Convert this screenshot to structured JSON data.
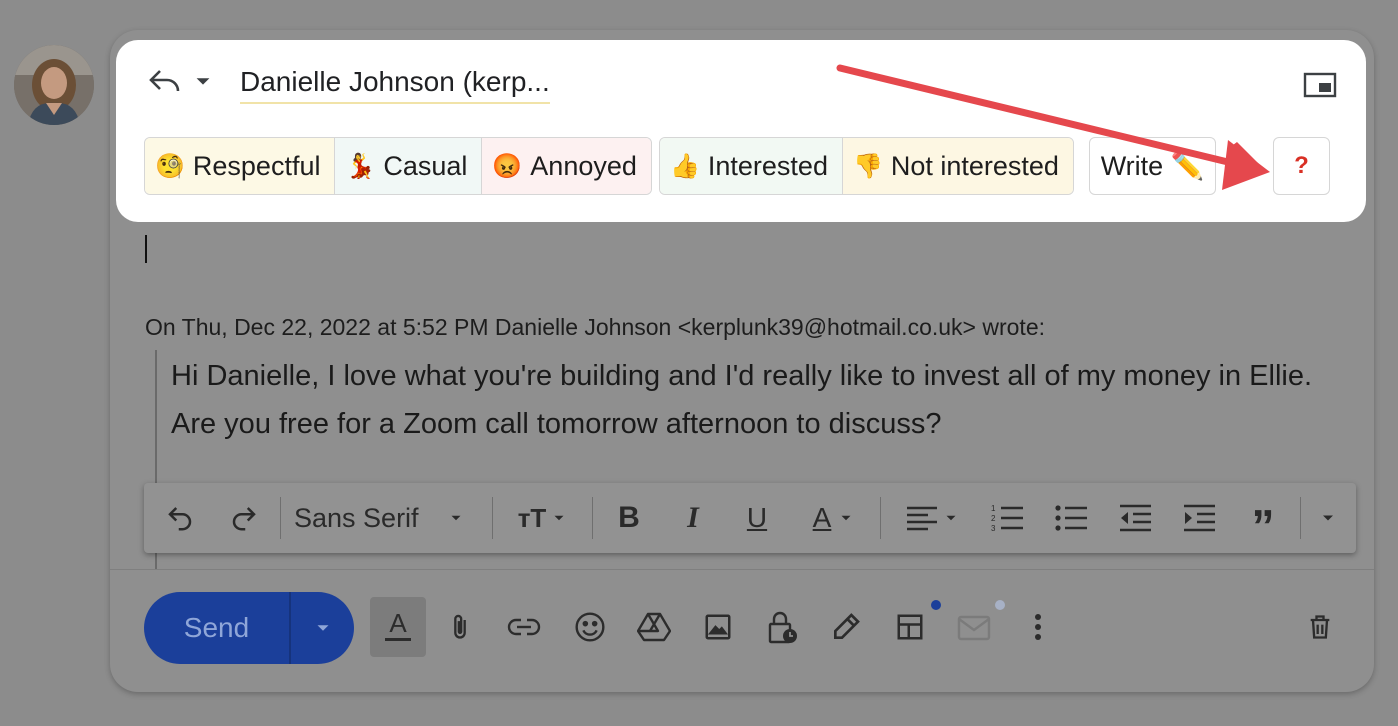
{
  "reply": {
    "recipient": "Danielle Johnson (kerp..."
  },
  "tones": {
    "group1": [
      {
        "emoji": "🧐",
        "label": "Respectful"
      },
      {
        "emoji": "💃",
        "label": "Casual"
      },
      {
        "emoji": "😡",
        "label": "Annoyed"
      }
    ],
    "group2": [
      {
        "emoji": "👍",
        "label": "Interested"
      },
      {
        "emoji": "👎",
        "label": "Not interested"
      }
    ],
    "write_label": "Write ✏️",
    "help_label": "?"
  },
  "quote": {
    "header": "On Thu, Dec 22, 2022 at 5:52 PM Danielle Johnson <kerplunk39@hotmail.co.uk> wrote:",
    "body": "Hi Danielle, I love what you're building and I'd really like to invest all of my money in Ellie. Are you free for a Zoom call tomorrow afternoon to discuss?"
  },
  "format_toolbar": {
    "font": "Sans Serif"
  },
  "bottom_toolbar": {
    "send_label": "Send"
  },
  "colors": {
    "send_bg": "#1b3f9a",
    "annotation_arrow": "#e5484d",
    "help_mark": "#d93025"
  }
}
